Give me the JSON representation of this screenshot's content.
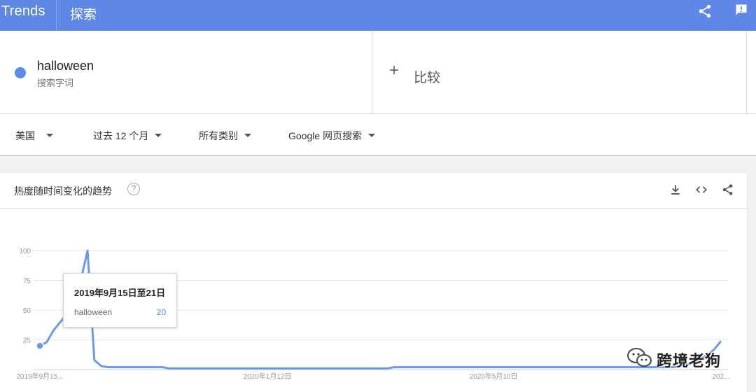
{
  "header": {
    "brand": "Trends",
    "nav_explore": "探索",
    "bg_color": "#5f87e6"
  },
  "term": {
    "name": "halloween",
    "subtitle": "搜索字词",
    "color": "#5b8ce8"
  },
  "compare": {
    "plus": "+",
    "label": "比较"
  },
  "filters": [
    {
      "label": "美国"
    },
    {
      "label": "过去 12 个月"
    },
    {
      "label": "所有类别"
    },
    {
      "label": "Google 网页搜索"
    }
  ],
  "card": {
    "title": "热度随时间变化的趋势",
    "help_glyph": "?",
    "icons": [
      "download-icon",
      "embed-code-icon",
      "share-icon"
    ]
  },
  "tooltip": {
    "date": "2019年9月15日至21日",
    "term": "halloween",
    "value": "20"
  },
  "watermark": {
    "text": "跨境老狗",
    "icon": "wechat-icon"
  },
  "chart_data": {
    "type": "line",
    "title": "热度随时间变化的趋势",
    "ylim": [
      0,
      100
    ],
    "yticks": [
      100,
      75,
      50,
      25
    ],
    "xtick_labels": [
      "2019年9月15...",
      "2020年1月12日",
      "2020年5月10日",
      "202..."
    ],
    "series": [
      {
        "name": "halloween",
        "values": [
          20,
          23,
          33,
          40,
          47,
          56,
          75,
          100,
          8,
          3,
          2,
          2,
          2,
          2,
          2,
          2,
          2,
          2,
          2,
          1,
          1,
          1,
          1,
          1,
          1,
          1,
          1,
          1,
          1,
          1,
          1,
          1,
          1,
          1,
          1,
          1,
          1,
          1,
          1,
          1,
          1,
          1,
          1,
          1,
          1,
          1,
          1,
          1,
          1,
          1,
          1,
          1,
          2,
          2,
          2,
          2,
          2,
          2,
          2,
          2,
          2,
          2,
          2,
          2,
          2,
          2,
          2,
          2,
          2,
          2,
          2,
          2,
          2,
          2,
          2,
          2,
          2,
          2,
          2,
          2,
          2,
          2,
          2,
          2,
          2,
          2,
          2,
          2,
          2,
          2,
          2,
          2,
          2,
          2,
          3,
          4,
          6,
          9,
          12,
          17,
          24
        ]
      }
    ]
  }
}
